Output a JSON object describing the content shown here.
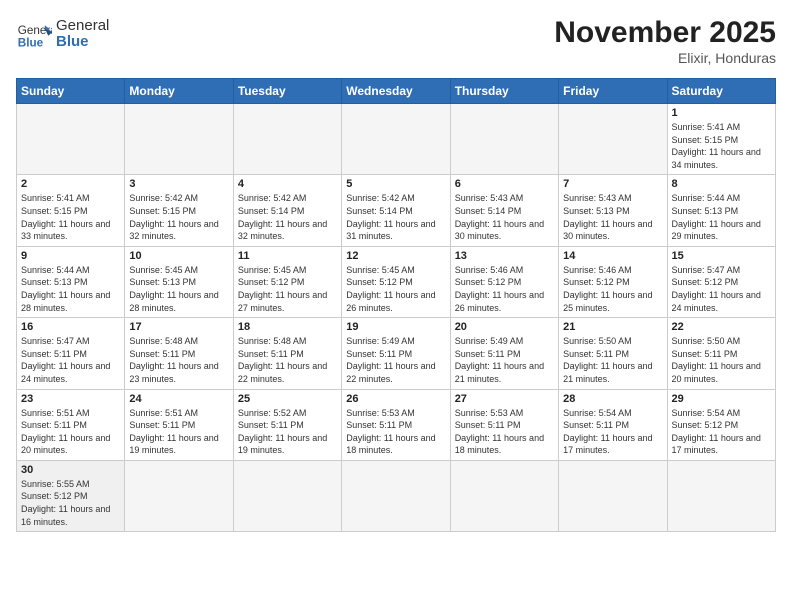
{
  "header": {
    "logo_general": "General",
    "logo_blue": "Blue",
    "month_year": "November 2025",
    "location": "Elixir, Honduras"
  },
  "weekdays": [
    "Sunday",
    "Monday",
    "Tuesday",
    "Wednesday",
    "Thursday",
    "Friday",
    "Saturday"
  ],
  "days": [
    {
      "num": "",
      "sunrise": "",
      "sunset": "",
      "daylight": ""
    },
    {
      "num": "",
      "sunrise": "",
      "sunset": "",
      "daylight": ""
    },
    {
      "num": "",
      "sunrise": "",
      "sunset": "",
      "daylight": ""
    },
    {
      "num": "",
      "sunrise": "",
      "sunset": "",
      "daylight": ""
    },
    {
      "num": "",
      "sunrise": "",
      "sunset": "",
      "daylight": ""
    },
    {
      "num": "",
      "sunrise": "",
      "sunset": "",
      "daylight": ""
    },
    {
      "num": "1",
      "sunrise": "Sunrise: 5:41 AM",
      "sunset": "Sunset: 5:15 PM",
      "daylight": "Daylight: 11 hours and 34 minutes."
    },
    {
      "num": "2",
      "sunrise": "Sunrise: 5:41 AM",
      "sunset": "Sunset: 5:15 PM",
      "daylight": "Daylight: 11 hours and 33 minutes."
    },
    {
      "num": "3",
      "sunrise": "Sunrise: 5:42 AM",
      "sunset": "Sunset: 5:15 PM",
      "daylight": "Daylight: 11 hours and 32 minutes."
    },
    {
      "num": "4",
      "sunrise": "Sunrise: 5:42 AM",
      "sunset": "Sunset: 5:14 PM",
      "daylight": "Daylight: 11 hours and 32 minutes."
    },
    {
      "num": "5",
      "sunrise": "Sunrise: 5:42 AM",
      "sunset": "Sunset: 5:14 PM",
      "daylight": "Daylight: 11 hours and 31 minutes."
    },
    {
      "num": "6",
      "sunrise": "Sunrise: 5:43 AM",
      "sunset": "Sunset: 5:14 PM",
      "daylight": "Daylight: 11 hours and 30 minutes."
    },
    {
      "num": "7",
      "sunrise": "Sunrise: 5:43 AM",
      "sunset": "Sunset: 5:13 PM",
      "daylight": "Daylight: 11 hours and 30 minutes."
    },
    {
      "num": "8",
      "sunrise": "Sunrise: 5:44 AM",
      "sunset": "Sunset: 5:13 PM",
      "daylight": "Daylight: 11 hours and 29 minutes."
    },
    {
      "num": "9",
      "sunrise": "Sunrise: 5:44 AM",
      "sunset": "Sunset: 5:13 PM",
      "daylight": "Daylight: 11 hours and 28 minutes."
    },
    {
      "num": "10",
      "sunrise": "Sunrise: 5:45 AM",
      "sunset": "Sunset: 5:13 PM",
      "daylight": "Daylight: 11 hours and 28 minutes."
    },
    {
      "num": "11",
      "sunrise": "Sunrise: 5:45 AM",
      "sunset": "Sunset: 5:12 PM",
      "daylight": "Daylight: 11 hours and 27 minutes."
    },
    {
      "num": "12",
      "sunrise": "Sunrise: 5:45 AM",
      "sunset": "Sunset: 5:12 PM",
      "daylight": "Daylight: 11 hours and 26 minutes."
    },
    {
      "num": "13",
      "sunrise": "Sunrise: 5:46 AM",
      "sunset": "Sunset: 5:12 PM",
      "daylight": "Daylight: 11 hours and 26 minutes."
    },
    {
      "num": "14",
      "sunrise": "Sunrise: 5:46 AM",
      "sunset": "Sunset: 5:12 PM",
      "daylight": "Daylight: 11 hours and 25 minutes."
    },
    {
      "num": "15",
      "sunrise": "Sunrise: 5:47 AM",
      "sunset": "Sunset: 5:12 PM",
      "daylight": "Daylight: 11 hours and 24 minutes."
    },
    {
      "num": "16",
      "sunrise": "Sunrise: 5:47 AM",
      "sunset": "Sunset: 5:11 PM",
      "daylight": "Daylight: 11 hours and 24 minutes."
    },
    {
      "num": "17",
      "sunrise": "Sunrise: 5:48 AM",
      "sunset": "Sunset: 5:11 PM",
      "daylight": "Daylight: 11 hours and 23 minutes."
    },
    {
      "num": "18",
      "sunrise": "Sunrise: 5:48 AM",
      "sunset": "Sunset: 5:11 PM",
      "daylight": "Daylight: 11 hours and 22 minutes."
    },
    {
      "num": "19",
      "sunrise": "Sunrise: 5:49 AM",
      "sunset": "Sunset: 5:11 PM",
      "daylight": "Daylight: 11 hours and 22 minutes."
    },
    {
      "num": "20",
      "sunrise": "Sunrise: 5:49 AM",
      "sunset": "Sunset: 5:11 PM",
      "daylight": "Daylight: 11 hours and 21 minutes."
    },
    {
      "num": "21",
      "sunrise": "Sunrise: 5:50 AM",
      "sunset": "Sunset: 5:11 PM",
      "daylight": "Daylight: 11 hours and 21 minutes."
    },
    {
      "num": "22",
      "sunrise": "Sunrise: 5:50 AM",
      "sunset": "Sunset: 5:11 PM",
      "daylight": "Daylight: 11 hours and 20 minutes."
    },
    {
      "num": "23",
      "sunrise": "Sunrise: 5:51 AM",
      "sunset": "Sunset: 5:11 PM",
      "daylight": "Daylight: 11 hours and 20 minutes."
    },
    {
      "num": "24",
      "sunrise": "Sunrise: 5:51 AM",
      "sunset": "Sunset: 5:11 PM",
      "daylight": "Daylight: 11 hours and 19 minutes."
    },
    {
      "num": "25",
      "sunrise": "Sunrise: 5:52 AM",
      "sunset": "Sunset: 5:11 PM",
      "daylight": "Daylight: 11 hours and 19 minutes."
    },
    {
      "num": "26",
      "sunrise": "Sunrise: 5:53 AM",
      "sunset": "Sunset: 5:11 PM",
      "daylight": "Daylight: 11 hours and 18 minutes."
    },
    {
      "num": "27",
      "sunrise": "Sunrise: 5:53 AM",
      "sunset": "Sunset: 5:11 PM",
      "daylight": "Daylight: 11 hours and 18 minutes."
    },
    {
      "num": "28",
      "sunrise": "Sunrise: 5:54 AM",
      "sunset": "Sunset: 5:11 PM",
      "daylight": "Daylight: 11 hours and 17 minutes."
    },
    {
      "num": "29",
      "sunrise": "Sunrise: 5:54 AM",
      "sunset": "Sunset: 5:12 PM",
      "daylight": "Daylight: 11 hours and 17 minutes."
    },
    {
      "num": "30",
      "sunrise": "Sunrise: 5:55 AM",
      "sunset": "Sunset: 5:12 PM",
      "daylight": "Daylight: 11 hours and 16 minutes."
    }
  ]
}
